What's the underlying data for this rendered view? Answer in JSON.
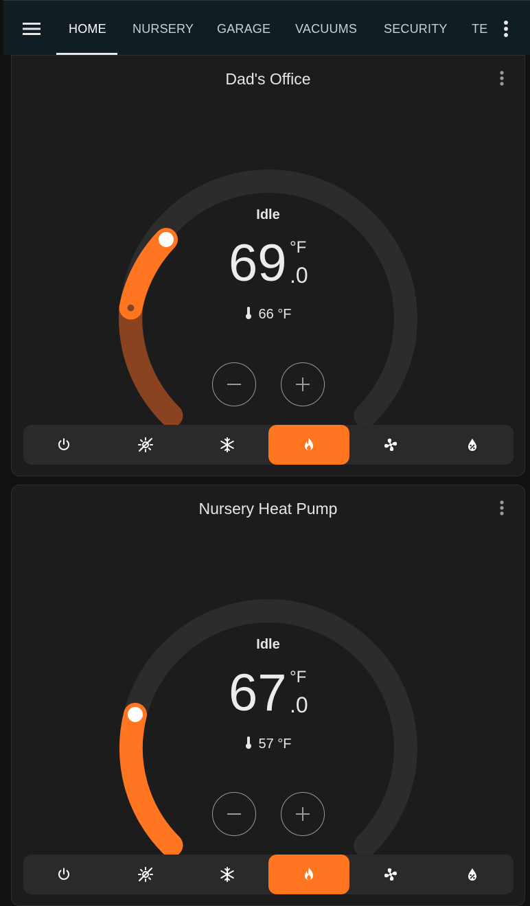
{
  "header": {
    "tabs": [
      {
        "label": "HOME",
        "active": true
      },
      {
        "label": "NURSERY",
        "active": false
      },
      {
        "label": "GARAGE",
        "active": false
      },
      {
        "label": "VACUUMS",
        "active": false
      },
      {
        "label": "SECURITY",
        "active": false
      },
      {
        "label": "TE",
        "active": false
      }
    ],
    "menu_icon": "hamburger-menu-icon",
    "overflow_icon": "dots-vertical-icon"
  },
  "colors": {
    "accent": "#ff7520",
    "arc_track": "#2c2c2c",
    "arc_dim": "#8a4320",
    "card_bg": "#1c1c1c",
    "header_bg": "#101e24"
  },
  "cards": [
    {
      "title": "Dad's Office",
      "mode": "Idle",
      "target_integer": "69",
      "target_decimal": ".0",
      "unit": "°F",
      "current": "66 °F",
      "selected_mode": "heat",
      "hvac_modes": [
        "off",
        "heat-cool",
        "cool",
        "heat",
        "fan-only",
        "dry"
      ]
    },
    {
      "title": "Nursery Heat Pump",
      "mode": "Idle",
      "target_integer": "67",
      "target_decimal": ".0",
      "unit": "°F",
      "current": "57 °F",
      "selected_mode": "heat",
      "hvac_modes": [
        "off",
        "heat-cool",
        "cool",
        "heat",
        "fan-only",
        "dry"
      ]
    }
  ]
}
